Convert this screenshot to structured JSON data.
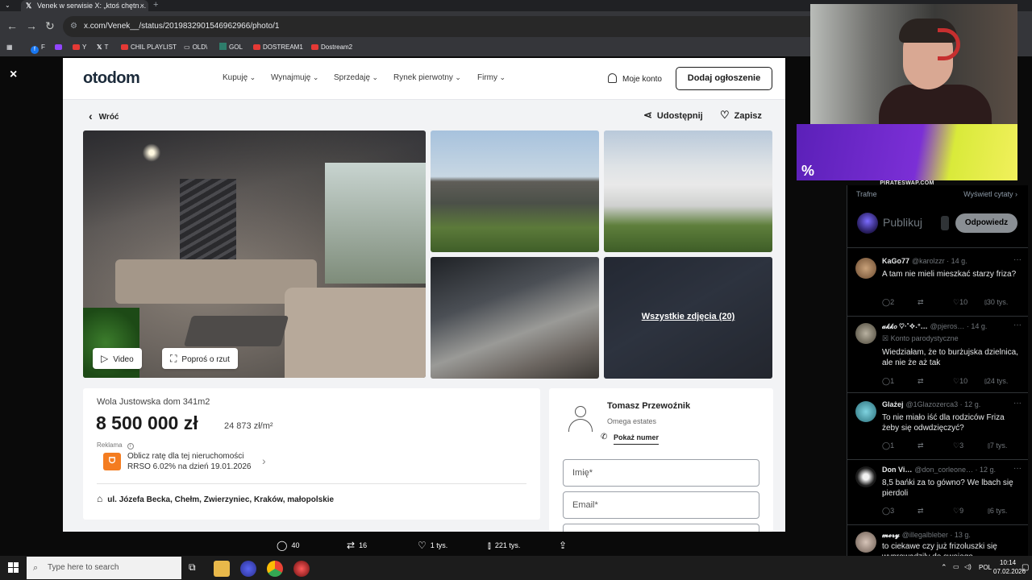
{
  "browser": {
    "tab_title": "Venek w serwisie X: „ktoś chętn…",
    "tab_close": "×",
    "new_tab": "+",
    "url": "x.com/Venek__/status/2019832901546962966/photo/1",
    "bookmarks": [
      {
        "label": "F",
        "icon": "facebook-icon"
      },
      {
        "label": "",
        "icon": "twitch-icon"
      },
      {
        "label": "Y",
        "icon": "youtube-icon"
      },
      {
        "label": "T",
        "icon": "x-icon"
      },
      {
        "label": "CHIL PLAYLIST",
        "icon": "youtube-icon"
      },
      {
        "label": "OLD\\",
        "icon": "folder-icon"
      },
      {
        "label": "GOL",
        "icon": "gol-icon"
      },
      {
        "label": "DOSTREAM1",
        "icon": "youtube-icon"
      },
      {
        "label": "Dostream2",
        "icon": "youtube-icon"
      }
    ]
  },
  "lightbox": {
    "close": "×"
  },
  "listing": {
    "logo": "otodom",
    "nav": [
      "Kupuję",
      "Wynajmuję",
      "Sprzedaję",
      "Rynek pierwotny",
      "Firmy"
    ],
    "account": "Moje konto",
    "add_listing": "Dodaj ogłoszenie",
    "back": "Wróć",
    "share": "Udostępnij",
    "save": "Zapisz",
    "video_btn": "Video",
    "floorplan_btn": "Poproś o rzut",
    "all_photos": "Wszystkie zdjęcia (20)",
    "title": "Wola Justowska dom 341m2",
    "price": "8 500 000 zł",
    "price_per_m2": "24 873 zł/m²",
    "ad_label": "Reklama",
    "ad_line1": "Oblicz ratę dla tej nieruchomości",
    "ad_line2": "RRSO 6.02% na dzień 19.01.2026",
    "address": "ul. Józefa Becka, Chełm, Zwierzyniec, Kraków, małopolskie",
    "agent_name": "Tomasz Przewoźnik",
    "agent_company": "Omega estates",
    "show_number": "Pokaż numer",
    "field_name": "Imię*",
    "field_email": "Email*"
  },
  "engagement": {
    "replies": "40",
    "reposts": "16",
    "likes": "1 tys.",
    "views": "221 tys."
  },
  "twitter": {
    "promo_label": "PIRATESWAP.COM",
    "sort_left": "Trafne",
    "sort_right": "Wyświetl cytaty",
    "compose_placeholder": "Publikuj",
    "reply_button": "Odpowiedz",
    "tweets": [
      {
        "name": "KaGo77",
        "handle": "@karolzzr · 14 g.",
        "sub": "",
        "text": "A tam nie mieli mieszkać starzy friza?",
        "replies": "2",
        "reposts": "",
        "likes": "10",
        "views": "30 tys."
      },
      {
        "name": "𝒶𝓀𝓀𝑜 ♡·˚✧˖°…",
        "handle": "@pjeros… · 14 g.",
        "sub": "Konto parodystyczne",
        "text": "Wiedziałam, że to burżujska dzielnica, ale nie że aż tak",
        "replies": "1",
        "reposts": "",
        "likes": "10",
        "views": "24 tys."
      },
      {
        "name": "Glażej",
        "handle": "@1Glazozerca3 · 12 g.",
        "sub": "",
        "text": "To nie miało iść dla rodziców Friza żeby się odwdzięczyć?",
        "replies": "1",
        "reposts": "",
        "likes": "3",
        "views": "7 tys."
      },
      {
        "name": "Don Vi…",
        "handle": "@don_corleone… · 12 g.",
        "sub": "",
        "text": "8,5 bańki za to gówno? We lbach się pierdoli",
        "replies": "3",
        "reposts": "",
        "likes": "9",
        "views": "6 tys."
      },
      {
        "name": "𝓶𝓮𝓻𝔂",
        "handle": "@illegalbleber · 13 g.",
        "sub": "",
        "text": "to ciekawe czy już frizoluszki się wyprowadziły do swojego",
        "replies": "",
        "reposts": "",
        "likes": "",
        "views": ""
      }
    ]
  },
  "taskbar": {
    "search_placeholder": "Type here to search",
    "lang": "POL",
    "time": "10:14",
    "date": "07.02.2026"
  },
  "colors": {
    "otodom_navy": "#1b2a3a",
    "twitter_bg": "#000000",
    "ad_orange": "#f47c20"
  }
}
